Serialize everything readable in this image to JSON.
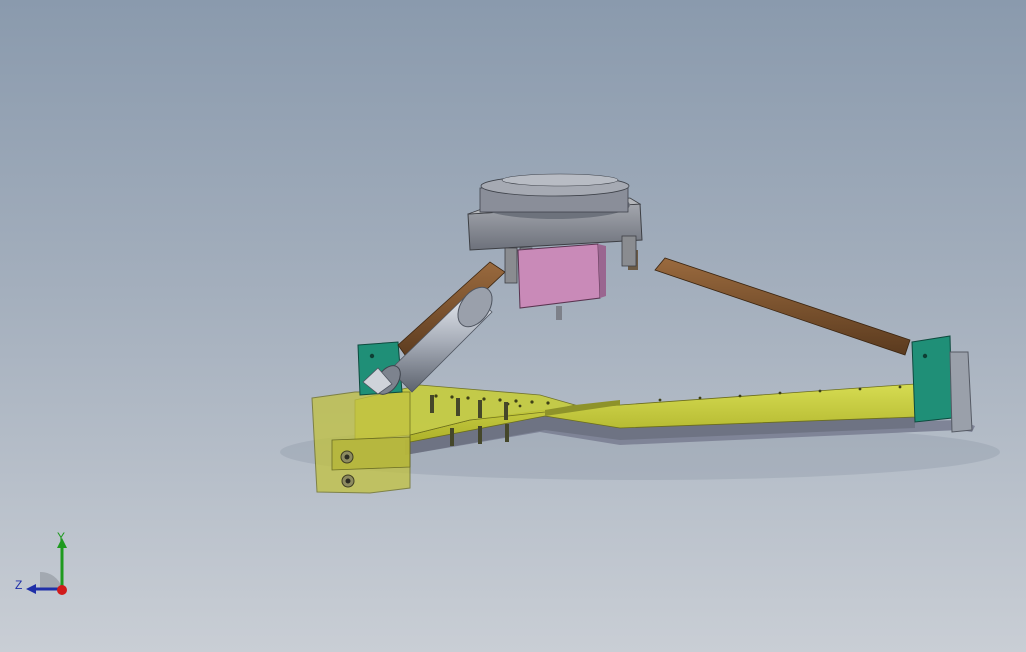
{
  "viewport": {
    "background_top": "#8a9aad",
    "background_bottom": "#c9ced5"
  },
  "model": {
    "description_icon": "cad-assembly-3d-model",
    "part_colors": {
      "frame": "#c6cc3c",
      "frame_underside": "#7f8497",
      "strut_left": "#6f4d2e",
      "strut_right": "#7a4f2a",
      "motor": "#c98ab8",
      "bracket": "#8d8a86",
      "turntable": "#8a8e99",
      "mount_green": "#1f8f77"
    }
  },
  "triad": {
    "y_label": "Y",
    "z_label": "Z",
    "x_color": "#d11a1a",
    "y_color": "#1f9a1f",
    "z_color": "#1f2fa8"
  }
}
